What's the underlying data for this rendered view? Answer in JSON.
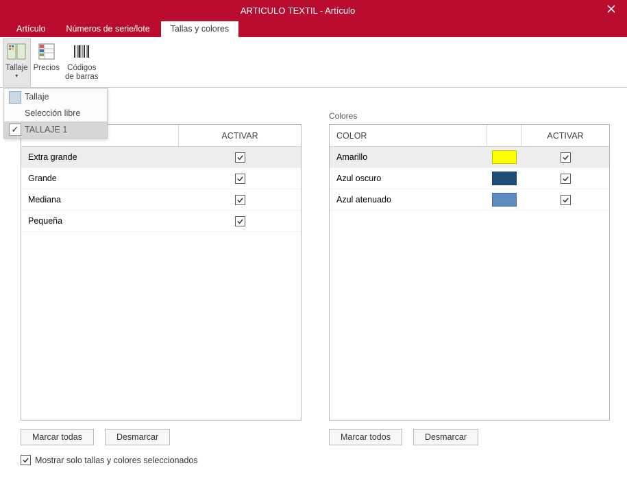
{
  "titlebar": {
    "title": "ARTICULO TEXTIL - Artículo"
  },
  "tabs": [
    {
      "label": "Artículo",
      "active": false
    },
    {
      "label": "Números de serie/lote",
      "active": false
    },
    {
      "label": "Tallas y colores",
      "active": true
    }
  ],
  "ribbon": {
    "tallaje": "Tallaje",
    "precios": "Precios",
    "codigos": "Códigos\nde barras"
  },
  "dropdown": {
    "items": [
      {
        "label": "Tallaje",
        "icon": "tallaje"
      },
      {
        "label": "Selección libre"
      },
      {
        "label": "TALLAJE 1",
        "checked": true,
        "selected": true
      }
    ]
  },
  "left": {
    "title": "",
    "header_name": "",
    "header_activar": "ACTIVAR",
    "rows": [
      {
        "name": "Extra grande",
        "active": true,
        "selected": true
      },
      {
        "name": "Grande",
        "active": true
      },
      {
        "name": "Mediana",
        "active": true
      },
      {
        "name": "Pequeña",
        "active": true
      }
    ],
    "mark_all": "Marcar todas",
    "unmark": "Desmarcar"
  },
  "right": {
    "title": "Colores",
    "header_name": "COLOR",
    "header_activar": "ACTIVAR",
    "rows": [
      {
        "name": "Amarillo",
        "color": "#ffff00",
        "active": true,
        "selected": true
      },
      {
        "name": "Azul oscuro",
        "color": "#1f4e79",
        "active": true
      },
      {
        "name": "Azul atenuado",
        "color": "#5b8bbf",
        "active": true
      }
    ],
    "mark_all": "Marcar todos",
    "unmark": "Desmarcar"
  },
  "footer": {
    "show_selected": "Mostrar solo tallas y colores seleccionados",
    "show_selected_checked": true
  }
}
